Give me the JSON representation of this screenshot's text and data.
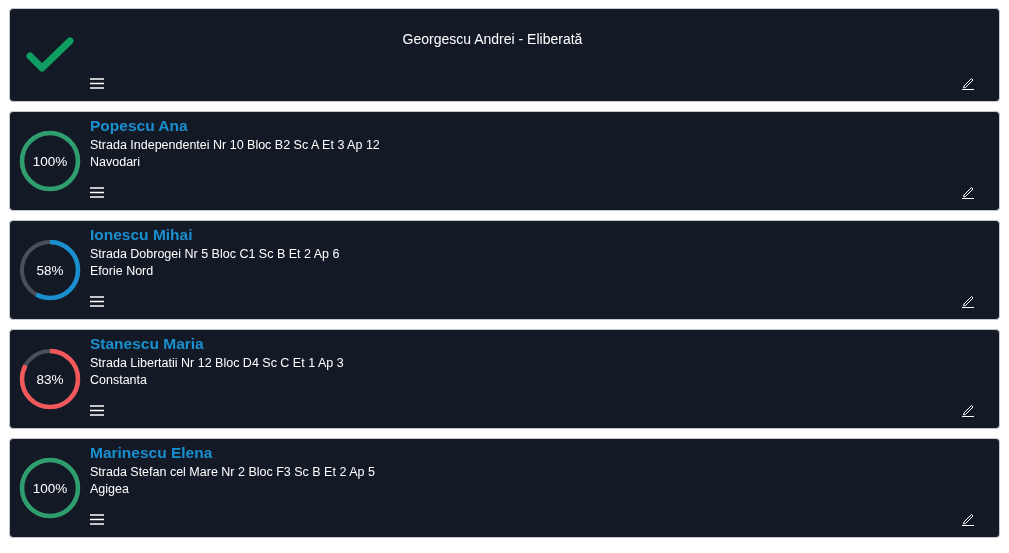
{
  "header": {
    "title": "Georgescu Andrei - Eliberată",
    "status": {
      "kind": "done"
    }
  },
  "people": [
    {
      "name": "Popescu Ana",
      "address": "Strada Independentei Nr 10 Bloc B2 Sc A Et 3 Ap 12",
      "city": "Navodari",
      "progress": {
        "label": "100%",
        "color": "#2e9e6e"
      }
    },
    {
      "name": "Ionescu Mihai",
      "address": "Strada Dobrogei Nr 5 Bloc C1 Sc B Et 2 Ap 6",
      "city": "Eforie Nord",
      "progress": {
        "label": "58%",
        "color": "#1a8fd0"
      }
    },
    {
      "name": "Stanescu Maria",
      "address": "Strada Libertatii Nr 12 Bloc D4 Sc C Et 1 Ap 3",
      "city": "Constanta",
      "progress": {
        "label": "83%",
        "color": "#f0585a"
      }
    },
    {
      "name": "Marinescu Elena",
      "address": "Strada Stefan cel Mare Nr 2 Bloc F3 Sc B Et 2 Ap 5",
      "city": "Agigea",
      "progress": {
        "label": "100%",
        "color": "#2e9e6e"
      }
    }
  ]
}
